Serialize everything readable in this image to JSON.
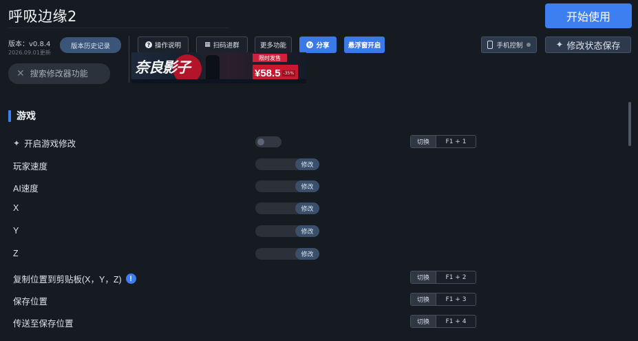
{
  "app": {
    "title": "呼吸边缘2",
    "start_button": "开始使用"
  },
  "version": {
    "label": "版本：v0.8.4",
    "date": "2026.09.01更新",
    "history_button": "版本历史记录"
  },
  "toolbar": {
    "manual": "操作说明",
    "qr_group": "扫码进群",
    "more": "更多功能",
    "share": "分享",
    "float_window": "悬浮窗开启",
    "phone_control": "手机控制",
    "save_state": "修改状态保存"
  },
  "search": {
    "placeholder": "搜索修改器功能"
  },
  "banner": {
    "logo": "奈良影子",
    "ribbon": "限时发售",
    "price": "¥58.5",
    "discount": "-35%"
  },
  "section": {
    "title": "游戏"
  },
  "controls": {
    "modify_label": "修改",
    "switch_label": "切换"
  },
  "rows": [
    {
      "label": "开启游戏修改",
      "control": "toggle",
      "hotkey": "F1 + 1",
      "enabled": false
    },
    {
      "label": "玩家速度",
      "control": "modify"
    },
    {
      "label": "AI速度",
      "control": "modify"
    },
    {
      "label": "X",
      "control": "modify"
    },
    {
      "label": "Y",
      "control": "modify"
    },
    {
      "label": "Z",
      "control": "modify"
    },
    {
      "label": "复制位置到剪贴板(X，Y，Z)",
      "control": "hotkey",
      "hotkey": "F1 + 2",
      "info": true
    },
    {
      "label": "保存位置",
      "control": "hotkey",
      "hotkey": "F1 + 3"
    },
    {
      "label": "传送至保存位置",
      "control": "hotkey",
      "hotkey": "F1 + 4"
    }
  ],
  "colors": {
    "background": "#161b22",
    "accent": "#3d7ef0"
  }
}
